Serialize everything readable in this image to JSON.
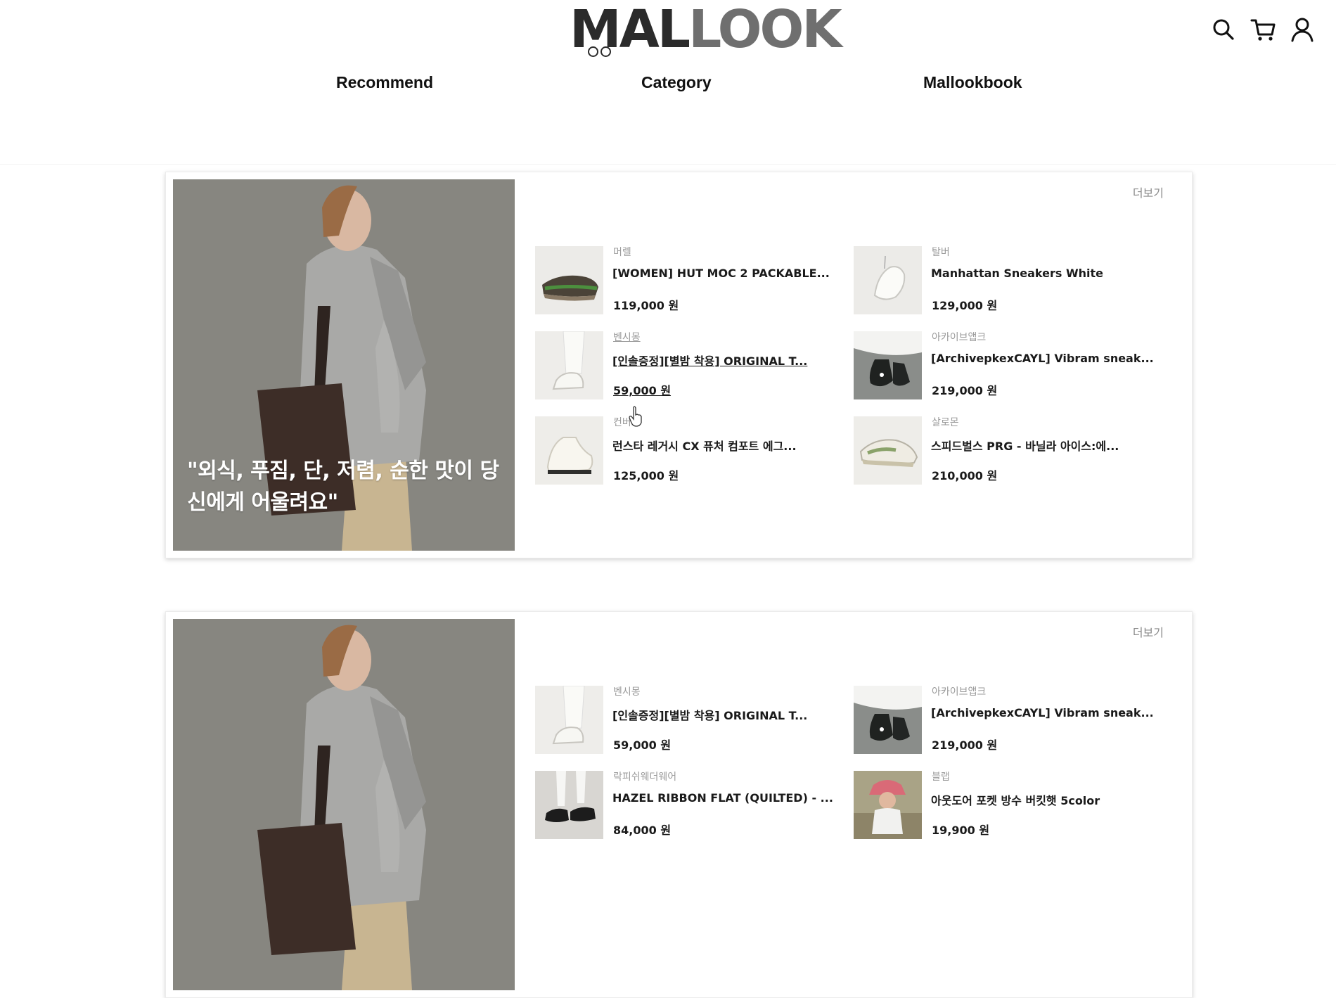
{
  "header": {
    "logo_part1": "MAL",
    "logo_part2": "LOOK",
    "nav": [
      {
        "label": "Recommend"
      },
      {
        "label": "Category"
      },
      {
        "label": "Mallookbook"
      }
    ],
    "icons": [
      "search-icon",
      "cart-icon",
      "user-icon"
    ]
  },
  "cards": [
    {
      "more_label": "더보기",
      "quote": "\"외식, 푸짐, 단, 저렴, 순한 맛이 당신에게 어울려요\"",
      "products": [
        {
          "brand": "머렐",
          "name": "[WOMEN] HUT MOC 2 PACKABLE...",
          "price": "119,000 원"
        },
        {
          "brand": "탈버",
          "name": "Manhattan Sneakers White",
          "price": "129,000 원"
        },
        {
          "brand": "벤시몽",
          "name": "[인솔증정][별밤 착용] ORIGINAL T...",
          "price": "59,000 원"
        },
        {
          "brand": "아카이브앱크",
          "name": "[ArchivepkexCAYL] Vibram sneak...",
          "price": "219,000 원"
        },
        {
          "brand": "컨버스",
          "name": "런스타 레거시 CX 퓨처 컴포트 에그...",
          "price": "125,000 원"
        },
        {
          "brand": "살로몬",
          "name": "스피드벌스 PRG - 바닐라 아이스:에...",
          "price": "210,000 원"
        }
      ]
    },
    {
      "more_label": "더보기",
      "products": [
        {
          "brand": "벤시몽",
          "name": "[인솔증정][별밤 착용] ORIGINAL T...",
          "price": "59,000 원"
        },
        {
          "brand": "아카이브앱크",
          "name": "[ArchivepkexCAYL] Vibram sneak...",
          "price": "219,000 원"
        },
        {
          "brand": "락피쉬웨더웨어",
          "name": "HAZEL RIBBON FLAT (QUILTED) - ...",
          "price": "84,000 원"
        },
        {
          "brand": "블랩",
          "name": "아웃도어 포켓 방수 버킷햇 5color",
          "price": "19,900 원"
        }
      ]
    }
  ],
  "colors": {
    "hero_bg": "#8c8b84",
    "text": "#111111",
    "muted": "#9a9a9a"
  }
}
